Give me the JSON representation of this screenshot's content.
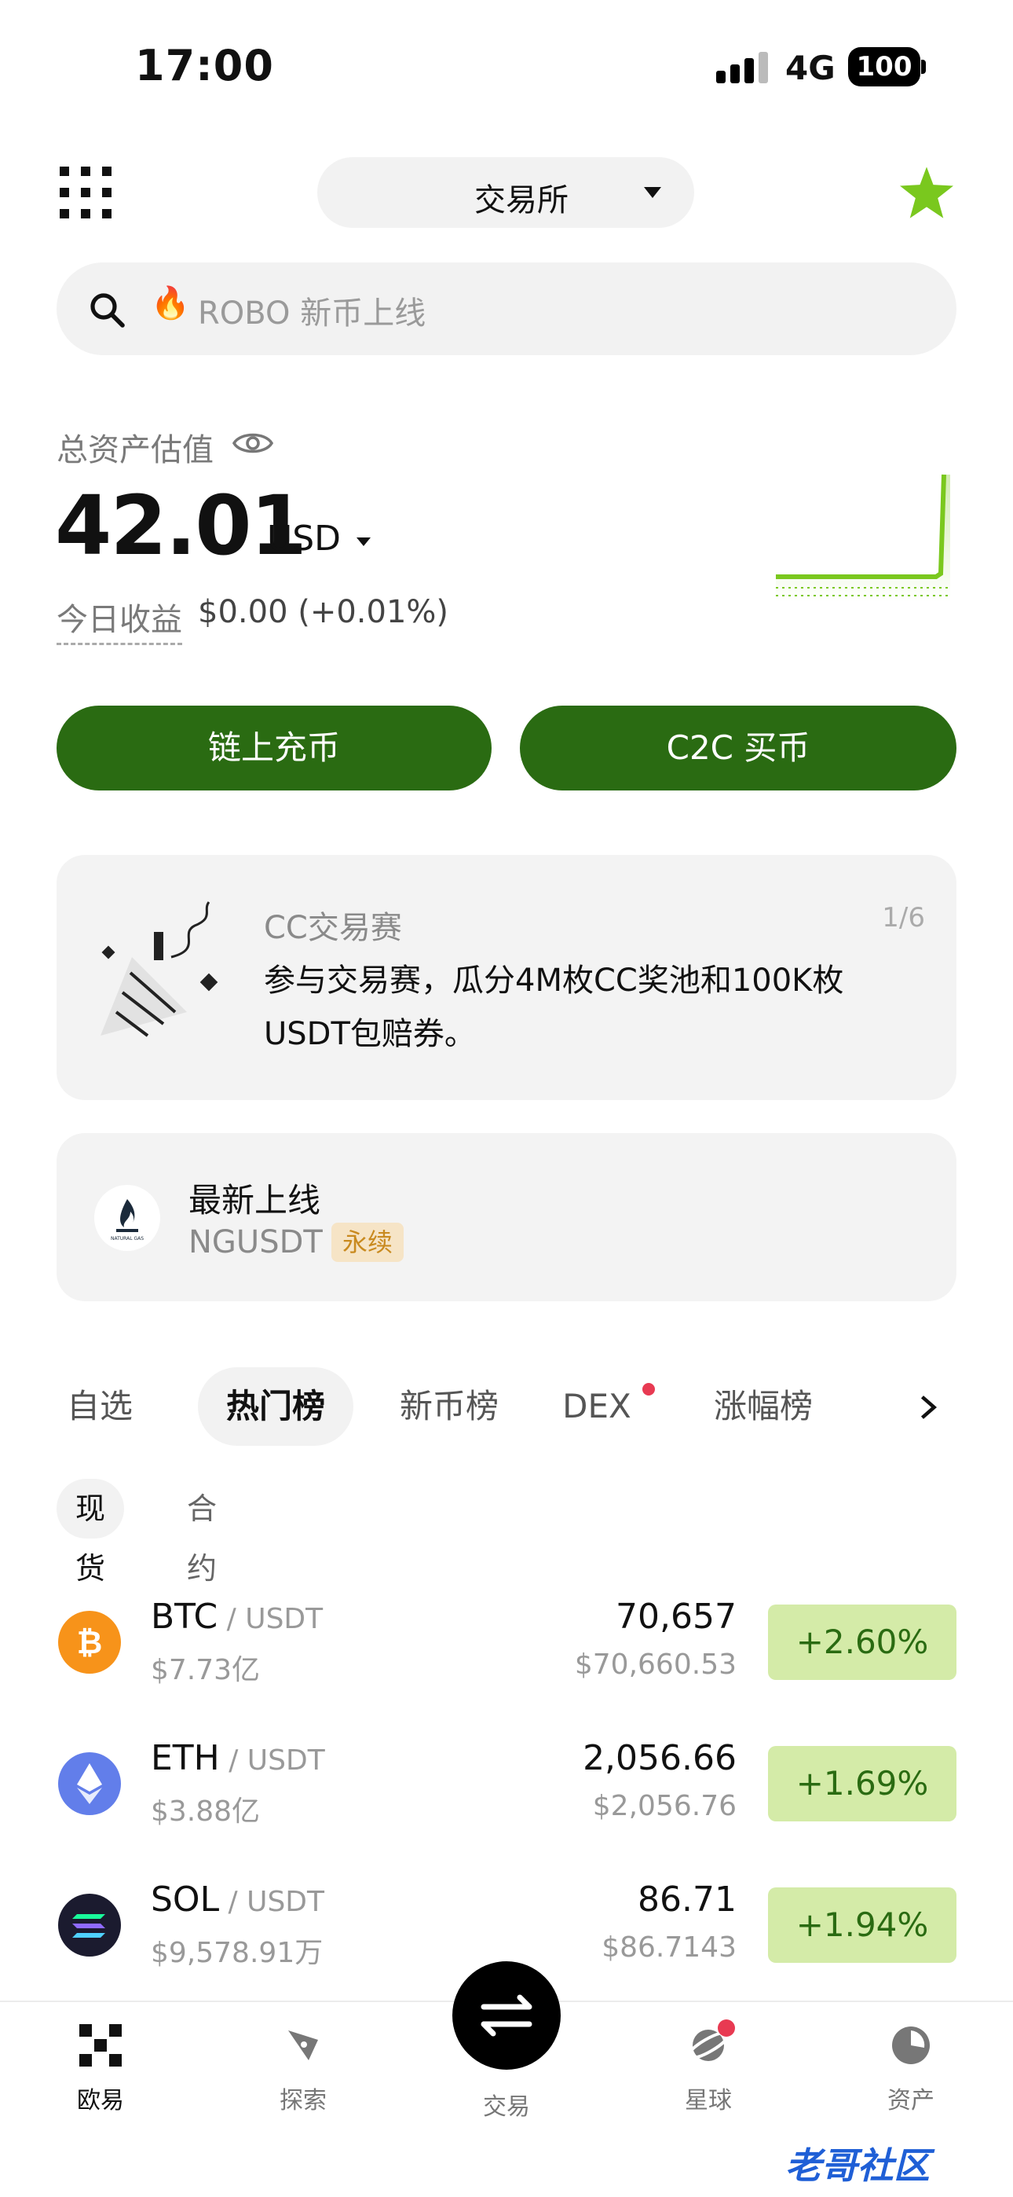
{
  "status_bar": {
    "time": "17:00",
    "network": "4G",
    "battery": "100"
  },
  "header": {
    "exchange_label": "交易所"
  },
  "search": {
    "placeholder": "ROBO 新币上线"
  },
  "assets": {
    "label": "总资产估值",
    "balance": "42.01",
    "currency": "USD",
    "pnl_label": "今日收益",
    "pnl_value": "$0.00 (+0.01%)"
  },
  "actions": {
    "deposit_label": "链上充币",
    "c2c_label": "C2C 买币"
  },
  "promo": {
    "title": "CC交易赛",
    "page": "1/6",
    "body": "参与交易赛，瓜分4M枚CC奖池和100K枚USDT包赔券。"
  },
  "listing": {
    "title": "最新上线",
    "symbol": "NGUSDT",
    "badge": "永续",
    "logo_text": "NATURAL GAS"
  },
  "tabs": [
    {
      "label": "自选"
    },
    {
      "label": "热门榜"
    },
    {
      "label": "新币榜"
    },
    {
      "label": "DEX"
    },
    {
      "label": "涨幅榜"
    }
  ],
  "subtabs": [
    {
      "label": "现货"
    },
    {
      "label": "合约"
    }
  ],
  "markets": [
    {
      "base": "BTC",
      "quote": " / USDT",
      "volume": "$7.73亿",
      "price": "70,657",
      "price_usd": "$70,660.53",
      "change": "+2.60%",
      "icon_color": "#f7931a",
      "icon": "bitcoin-icon"
    },
    {
      "base": "ETH",
      "quote": " / USDT",
      "volume": "$3.88亿",
      "price": "2,056.66",
      "price_usd": "$2,056.76",
      "change": "+1.69%",
      "icon_color": "#627eea",
      "icon": "ethereum-icon"
    },
    {
      "base": "SOL",
      "quote": " / USDT",
      "volume": "$9,578.91万",
      "price": "86.71",
      "price_usd": "$86.7143",
      "change": "+1.94%",
      "icon_color": "#1b1b2f",
      "icon": "solana-icon"
    }
  ],
  "nav": [
    {
      "label": "欧易"
    },
    {
      "label": "探索"
    },
    {
      "label": "交易"
    },
    {
      "label": "星球"
    },
    {
      "label": "资产"
    }
  ],
  "watermark": "老哥社区",
  "colors": {
    "accent_green": "#2a6b12",
    "positive_bg": "#d4eba8",
    "star_green": "#7ac81e",
    "alert_red": "#e83a52"
  }
}
